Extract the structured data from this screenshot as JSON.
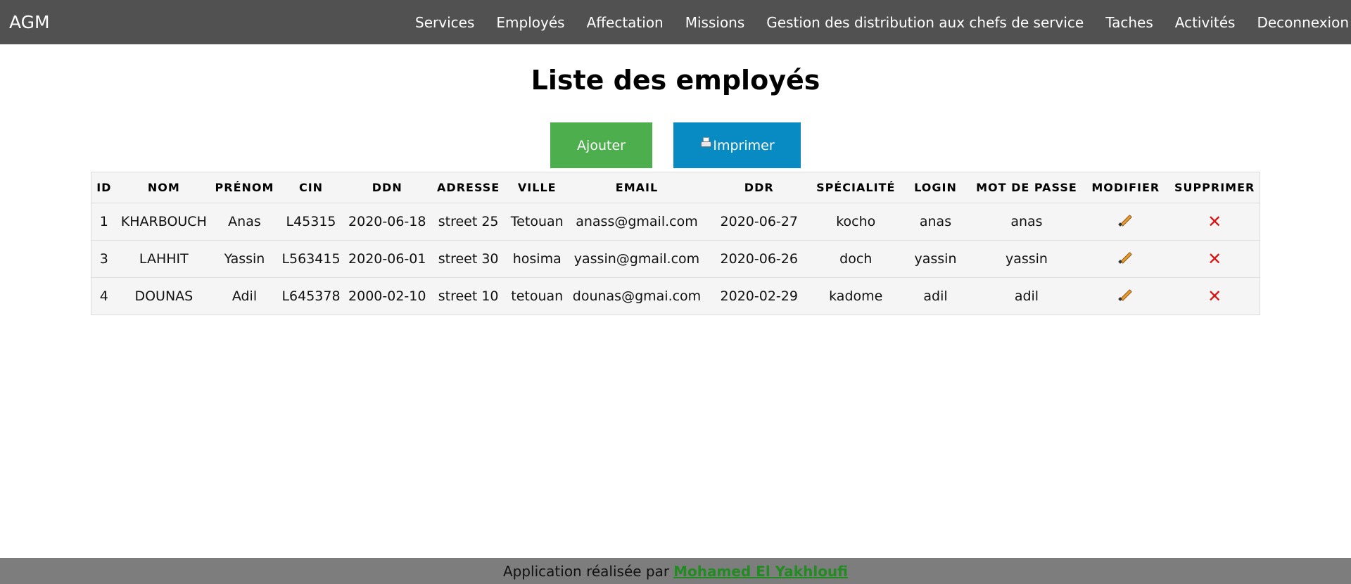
{
  "app": {
    "brand": "AGM"
  },
  "nav": {
    "items": [
      "Services",
      "Employés",
      "Affectation",
      "Missions",
      "Gestion des distribution aux chefs de service",
      "Taches",
      "Activités",
      "Deconnexion"
    ]
  },
  "page": {
    "title": "Liste des employés"
  },
  "buttons": {
    "add_label": "Ajouter",
    "print_label": "Imprimer"
  },
  "table": {
    "headers": [
      "ID",
      "NOM",
      "PRÉNOM",
      "CIN",
      "DDN",
      "ADRESSE",
      "VILLE",
      "EMAIL",
      "DDR",
      "SPÉCIALITÉ",
      "LOGIN",
      "MOT DE PASSE",
      "MODIFIER",
      "SUPPRIMER"
    ],
    "rows": [
      [
        "1",
        "KHARBOUCH",
        "Anas",
        "L45315",
        "2020-06-18",
        "street 25",
        "Tetouan",
        "anass@gmail.com",
        "2020-06-27",
        "kocho",
        "anas",
        "anas"
      ],
      [
        "3",
        "LAHHIT",
        "Yassin",
        "L563415",
        "2020-06-01",
        "street 30",
        "hosima",
        "yassin@gmail.com",
        "2020-06-26",
        "doch",
        "yassin",
        "yassin"
      ],
      [
        "4",
        "DOUNAS",
        "Adil",
        "L645378",
        "2000-02-10",
        "street 10",
        "tetouan",
        "dounas@gmai.com",
        "2020-02-29",
        "kadome",
        "adil",
        "adil"
      ]
    ],
    "edit_icon": "pencil-icon",
    "delete_icon": "close-icon",
    "delete_glyph": "✕"
  },
  "footer": {
    "text": "Application réalisée par",
    "author": "Mohamed El Yakhloufi"
  },
  "colors": {
    "navbar": "#515151",
    "add_button": "#4cae4c",
    "print_button": "#088bc2",
    "footer": "#7d7d7d",
    "footer_link": "#228b22",
    "delete": "#dd1111"
  }
}
